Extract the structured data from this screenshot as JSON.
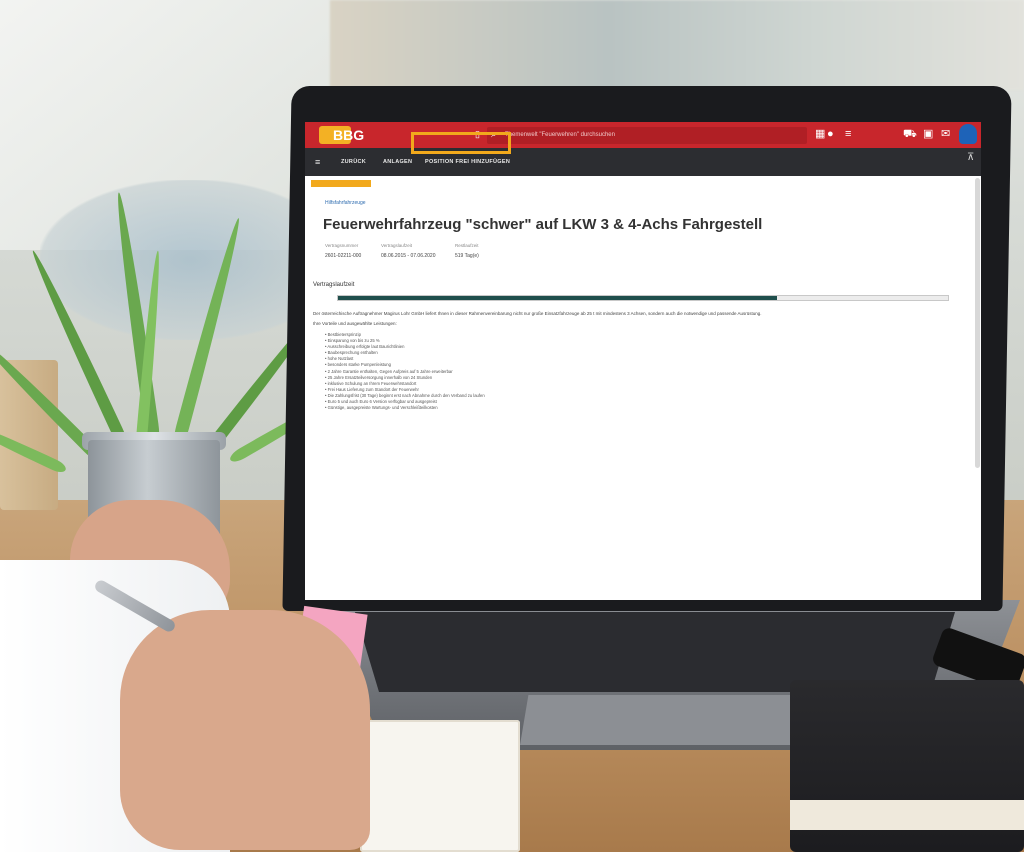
{
  "app": {
    "logo": "BBG",
    "search_placeholder": "Themenwelt \"Feuerwehren\" durchsuchen",
    "icons": [
      "grid-icon",
      "toggle-icon",
      "menu-icon",
      "cart-icon",
      "note-icon",
      "mail-icon",
      "user-icon"
    ],
    "colors": {
      "primary": "#c8262c",
      "nav": "#2c2d31",
      "accent": "#f2a91c",
      "progress": "#1f4f4c",
      "logo": "#f3b124"
    }
  },
  "nav": {
    "items": [
      "ZURÜCK",
      "ANLAGEN",
      "POSITION FREI HINZUFÜGEN"
    ]
  },
  "breadcrumb": "Hilfsfahrfahrzeuge",
  "product": {
    "title": "Feuerwehrfahrzeug \"schwer\" auf LKW 3 & 4-Achs Fahrgestell",
    "meta": [
      {
        "label": "Vertragsnummer",
        "value": "2601-02211-000"
      },
      {
        "label": "Vertragslaufzeit",
        "value": "08.06.2015 - 07.06.2020"
      },
      {
        "label": "Restlaufzeit",
        "value": "519 Tag(e)"
      }
    ]
  },
  "contract": {
    "label": "Vertragslaufzeit",
    "progress": 0.72
  },
  "description": "Der österreichische Auftragnehmer Magirus Lohr GmbH liefert Ihnen in dieser Rahmenvereinbarung nicht nur große Einsatzfahrzeuge ab 25 t mit mindestens 3 Achsen, sondern auch die notwendige und passende Ausrüstung.",
  "advantages_label": "Ihre Vorteile und ausgewählte Leistungen:",
  "advantages": [
    "Bestbietersprinzip",
    "Einsparung von bis zu 25 %",
    "Ausschreibung erfolgte laut Baurichtlinien",
    "Baubesprechung enthalten",
    "hohe Nutzlast",
    "besonders starke Pumpenleistung",
    "2 Jahre Garantie enthalten, Gegen Aufpreis auf 5 Jahre erweiterbar",
    "25 Jahre Ersatzteilversorgung innerhalb von 24 Stunden",
    "inklusive Schulung an Ihrem Feuerwehrstandort",
    "Frei Haus Lieferung zum Standort der Feuerwehr",
    "Die Zahlungsfrist (30 Tage) beginnt erst nach Abnahme durch den Verband zu laufen",
    "Euro 5 und auch Euro 6 Version verfügbar und ausgepreist",
    "Günstige, ausgepreiste Wartungs- und Verschleißteilkosten"
  ]
}
